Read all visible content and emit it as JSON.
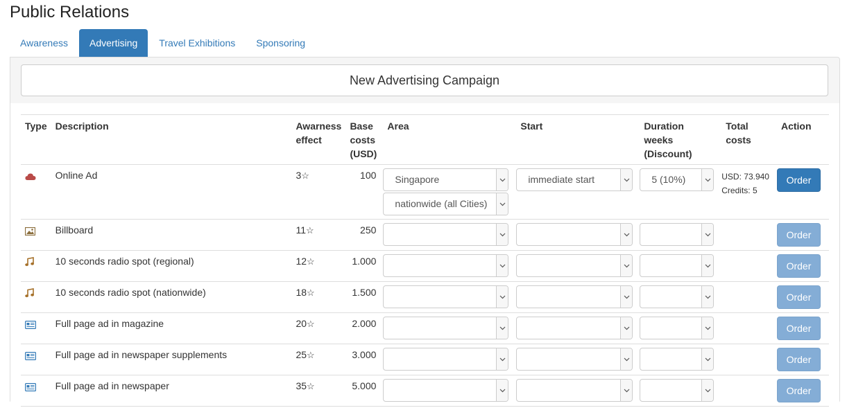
{
  "page": {
    "title": "Public Relations"
  },
  "tabs": [
    {
      "label": "Awareness",
      "active": false
    },
    {
      "label": "Advertising",
      "active": true
    },
    {
      "label": "Travel Exhibitions",
      "active": false
    },
    {
      "label": "Sponsoring",
      "active": false
    }
  ],
  "new_campaign_label": "New Advertising Campaign",
  "table": {
    "headers": {
      "type": "Type",
      "description": "Description",
      "awareness_line1": "Awarness",
      "awareness_line2": "effect",
      "base_line1": "Base",
      "base_line2": "costs",
      "base_line3": "(USD)",
      "area": "Area",
      "start": "Start",
      "duration_line1": "Duration",
      "duration_line2": "weeks",
      "duration_line3": "(Discount)",
      "total_line1": "Total",
      "total_line2": "costs",
      "action": "Action"
    },
    "star_glyph": "☆",
    "order_label": "Order",
    "rows": [
      {
        "icon": "cloud-icon",
        "description": "Online Ad",
        "awareness": "3",
        "base": "100",
        "area_value": "Singapore",
        "area_scope": "nationwide (all Cities)",
        "start_value": "immediate start",
        "duration_value": "5 (10%)",
        "total_usd": "USD: 73.940",
        "total_credits": "Credits: 5",
        "order_enabled": true
      },
      {
        "icon": "picture-icon",
        "description": "Billboard",
        "awareness": "11",
        "base": "250",
        "area_value": "",
        "area_scope": "",
        "start_value": "",
        "duration_value": "",
        "total_usd": "",
        "total_credits": "",
        "order_enabled": false
      },
      {
        "icon": "music-note-icon",
        "description": "10 seconds radio spot (regional)",
        "awareness": "12",
        "base": "1.000",
        "area_value": "",
        "area_scope": "",
        "start_value": "",
        "duration_value": "",
        "total_usd": "",
        "total_credits": "",
        "order_enabled": false
      },
      {
        "icon": "music-note-icon",
        "description": "10 seconds radio spot (nationwide)",
        "awareness": "18",
        "base": "1.500",
        "area_value": "",
        "area_scope": "",
        "start_value": "",
        "duration_value": "",
        "total_usd": "",
        "total_credits": "",
        "order_enabled": false
      },
      {
        "icon": "newspaper-icon",
        "description": "Full page ad in magazine",
        "awareness": "20",
        "base": "2.000",
        "area_value": "",
        "area_scope": "",
        "start_value": "",
        "duration_value": "",
        "total_usd": "",
        "total_credits": "",
        "order_enabled": false
      },
      {
        "icon": "newspaper-icon",
        "description": "Full page ad in newspaper supplements",
        "awareness": "25",
        "base": "3.000",
        "area_value": "",
        "area_scope": "",
        "start_value": "",
        "duration_value": "",
        "total_usd": "",
        "total_credits": "",
        "order_enabled": false
      },
      {
        "icon": "newspaper-icon",
        "description": "Full page ad in newspaper",
        "awareness": "35",
        "base": "5.000",
        "area_value": "",
        "area_scope": "",
        "start_value": "",
        "duration_value": "",
        "total_usd": "",
        "total_credits": "",
        "order_enabled": false
      }
    ]
  },
  "colors": {
    "primary": "#337ab7",
    "primary_disabled": "#84add6",
    "cloud_icon": "#b94a48",
    "music_icon": "#a6712a",
    "picture_icon": "#8a6d3b",
    "newspaper_icon": "#337ab7"
  }
}
